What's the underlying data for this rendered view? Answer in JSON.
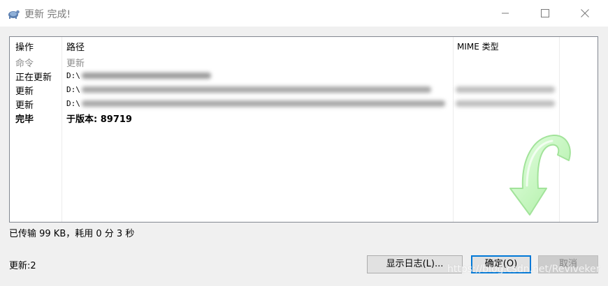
{
  "window": {
    "title": "更新 完成!"
  },
  "list": {
    "headers": {
      "action": "操作",
      "path": "路径",
      "mime": "MIME 类型"
    },
    "rows": [
      {
        "action": "命令",
        "path": "更新"
      },
      {
        "action": "正在更新",
        "path": "D:\\"
      },
      {
        "action": "更新",
        "path": "D:\\"
      },
      {
        "action": "更新",
        "path": "D:\\"
      },
      {
        "action": "完毕",
        "path": "于版本: 89719"
      }
    ]
  },
  "status": {
    "transfer": "已传输 99 KB，耗用 0 分 3 秒",
    "updates": "更新:2"
  },
  "buttons": {
    "show_log": "显示日志(L)...",
    "ok": "确定(O)",
    "cancel": "取消"
  },
  "watermark": "https://blog.csdn.net/Reviveker",
  "icons": {
    "app": "tortoise-icon",
    "status_arrow": "green-curved-arrow-icon"
  },
  "colors": {
    "accent": "#0078d7",
    "arrow": "#b9f3b6"
  }
}
